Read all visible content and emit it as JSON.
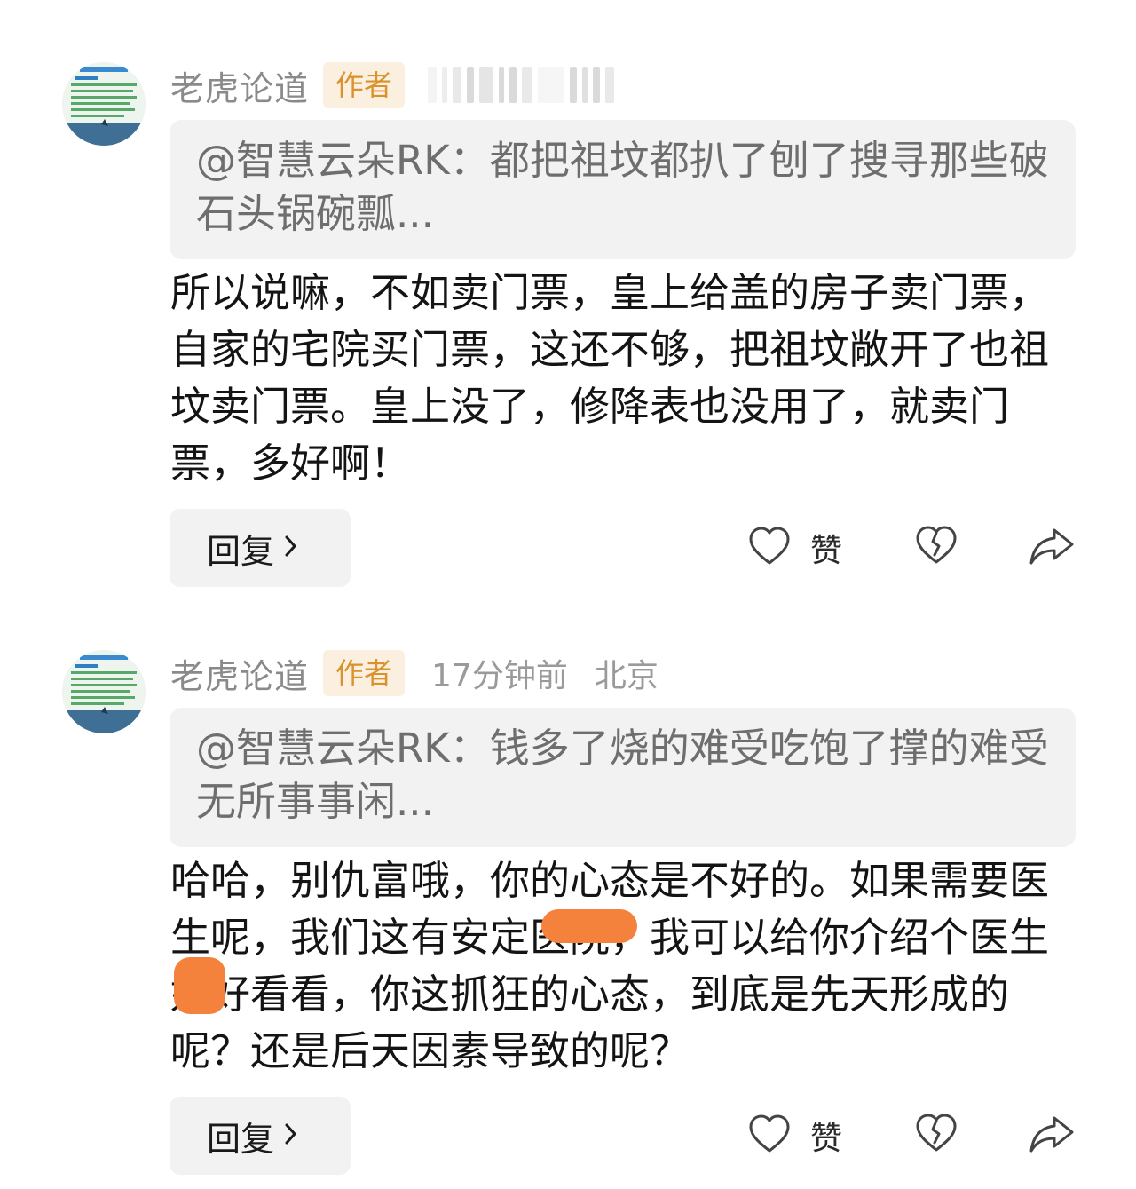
{
  "colors": {
    "badge_bg": "#fbf0df",
    "badge_text": "#d9922e",
    "quote_bg": "#f2f2f2",
    "redaction": "#f4823c"
  },
  "comments": [
    {
      "author": "老虎论道",
      "badge": "作者",
      "quote": "@智慧云朵RK：都把祖坟都扒了刨了搜寻那些破石头锅碗瓢...",
      "text": "所以说嘛，不如卖门票，皇上给盖的房子卖门票，自家的宅院买门票，这还不够，把祖坟敞开了也祖坟卖门票。皇上没了，修降表也没用了，就卖门票，多好啊！",
      "reply_label": "回复",
      "like_label": "赞",
      "icons": [
        "heart-icon",
        "broken-heart-icon",
        "share-icon",
        "chevron-right-icon"
      ]
    },
    {
      "author": "老虎论道",
      "badge": "作者",
      "time": "17分钟前",
      "location": "北京",
      "quote": "@智慧云朵RK：钱多了烧的难受吃饱了撑的难受无所事事闲...",
      "text": "哈哈，别仇富哦，你的心态是不好的。如果需要医生呢，我们这有安定医院，我可以给你介绍个医生好好看看，你这抓狂的心态，到底是先天形成的呢？还是后天因素导致的呢？",
      "reply_label": "回复",
      "like_label": "赞",
      "icons": [
        "heart-icon",
        "broken-heart-icon",
        "share-icon",
        "chevron-right-icon"
      ]
    }
  ]
}
